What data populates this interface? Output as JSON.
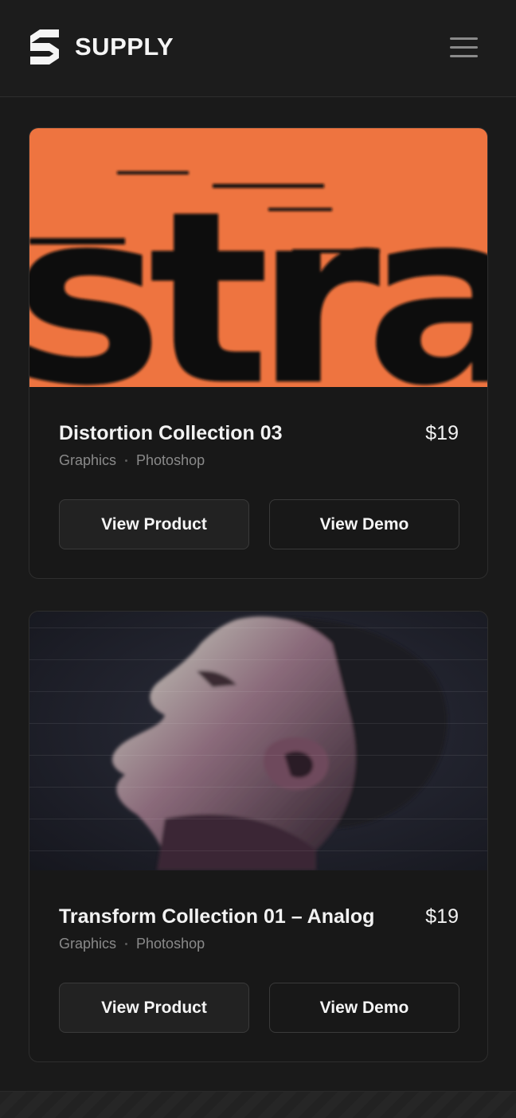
{
  "header": {
    "brand": "SUPPLY",
    "logo_icon": "supply-s-logo",
    "menu_icon": "hamburger-menu-icon"
  },
  "products": [
    {
      "title": "Distortion Collection 03",
      "price": "$19",
      "category": "Graphics",
      "software": "Photoshop",
      "image_text": "stra",
      "image_accent": "#ee7440",
      "view_product_label": "View Product",
      "view_demo_label": "View Demo"
    },
    {
      "title": "Transform Collection 01 – Analog",
      "price": "$19",
      "category": "Graphics",
      "software": "Photoshop",
      "view_product_label": "View Product",
      "view_demo_label": "View Demo"
    }
  ]
}
